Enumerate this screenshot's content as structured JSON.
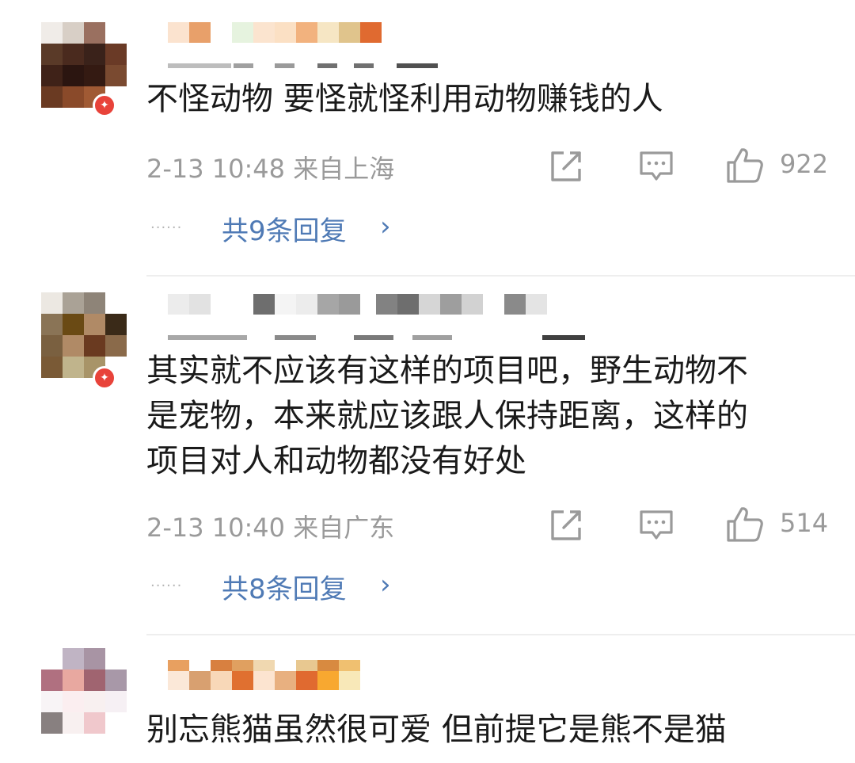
{
  "comments": [
    {
      "text": "不怪动物 要怪就怪利用动物赚钱的人",
      "meta": "2-13 10:48 来自上海",
      "likes": "922",
      "replies_label": "共9条回复",
      "reply_dots": "......"
    },
    {
      "text": "其实就不应该有这样的项目吧，野生动物不\n是宠物，本来就应该跟人保持距离，这样的\n项目对人和动物都没有好处",
      "meta": "2-13 10:40 来自广东",
      "likes": "514",
      "replies_label": "共8条回复",
      "reply_dots": "......"
    },
    {
      "text": "别忘熊猫虽然很可爱 但前提它是熊不是猫"
    }
  ],
  "icons": {
    "share": "share-icon",
    "comment": "comment-icon",
    "like": "thumbs-up-icon",
    "chevron": "chevron-right-icon"
  },
  "colors": {
    "link": "#4f7ab5",
    "meta": "#9a9a9a",
    "text": "#1a1a1a",
    "badge": "#e8433a"
  }
}
